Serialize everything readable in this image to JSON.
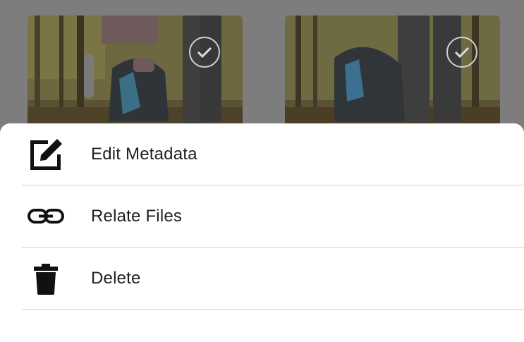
{
  "thumbnails": [
    {
      "icon": "checkmark-icon",
      "selected": false
    },
    {
      "icon": "checkmark-icon",
      "selected": false
    }
  ],
  "menu": {
    "items": [
      {
        "label": "Edit Metadata",
        "icon": "edit-icon"
      },
      {
        "label": "Relate Files",
        "icon": "link-icon"
      },
      {
        "label": "Delete",
        "icon": "trash-icon"
      }
    ]
  },
  "colors": {
    "overlay": "#7d7d7d",
    "sheet_background": "#ffffff",
    "text": "#212121",
    "divider": "#cfcfcf"
  }
}
